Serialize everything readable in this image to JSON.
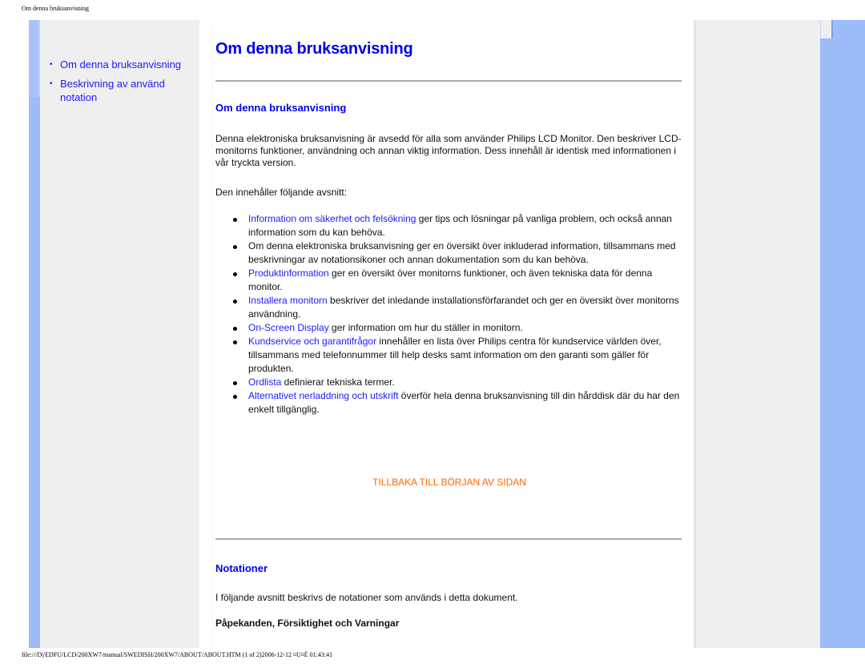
{
  "page": {
    "header_title": "Om denna bruksanvisning",
    "footer_path": "file:///D|/EDFU/LCD/200XW7/manual/SWEDISH/200XW7/ABOUT/ABOUT.HTM (1 of 2)2006-12-12 ¤U¤È 01:43:41"
  },
  "sidebar": {
    "items": [
      {
        "label": "Om denna bruksanvisning"
      },
      {
        "label": "Beskrivning av använd notation"
      }
    ],
    "bullet_icon": "•"
  },
  "main": {
    "title": "Om denna bruksanvisning",
    "section1": {
      "heading": "Om denna bruksanvisning",
      "intro": "Denna elektroniska bruksanvisning är avsedd för alla som använder Philips LCD Monitor. Den beskriver LCD-monitorns funktioner, användning och annan viktig information. Dess innehåll är identisk med informationen i vår tryckta version.",
      "list_intro": "Den innehåller följande avsnitt:",
      "items": [
        {
          "link": "Information om säkerhet och felsökning",
          "text": " ger tips och lösningar på vanliga problem, och också annan information som du kan behöva."
        },
        {
          "link": "",
          "text": "Om denna elektroniska bruksanvisning ger en översikt över inkluderad information, tillsammans med beskrivningar av notationsikoner och annan dokumentation som du kan behöva."
        },
        {
          "link": "Produktinformation",
          "text": " ger en översikt över monitorns funktioner, och även tekniska data för denna monitor."
        },
        {
          "link": "Installera monitorn",
          "text": " beskriver det inledande installationsförfarandet och ger en översikt över monitorns användning."
        },
        {
          "link": "On-Screen Display",
          "text": " ger information om hur du ställer in monitorn."
        },
        {
          "link": "Kundservice och garantifrågor",
          "text": " innehåller en lista över Philips centra för kundservice världen över, tillsammans med telefonnummer till help desks samt information om den garanti som gäller för produkten."
        },
        {
          "link": "Ordlista",
          "text": " definierar tekniska termer."
        },
        {
          "link": "Alternativet nerladdning och utskrift",
          "text": " överför hela denna bruksanvisning till din hårddisk där du har den enkelt tillgänglig."
        }
      ],
      "back_to_top": "TILLBAKA TILL BÖRJAN AV SIDAN"
    },
    "section2": {
      "heading": "Notationer",
      "intro": "I följande avsnitt beskrivs de notationer som används i detta dokument.",
      "subheading": "Påpekanden, Försiktighet och Varningar"
    }
  },
  "colors": {
    "link": "#1a1aff",
    "heading": "#0000ee",
    "back_to_top": "#ff6600",
    "accent_blue": "#9dbcf8",
    "panel_grey": "#efefef"
  }
}
